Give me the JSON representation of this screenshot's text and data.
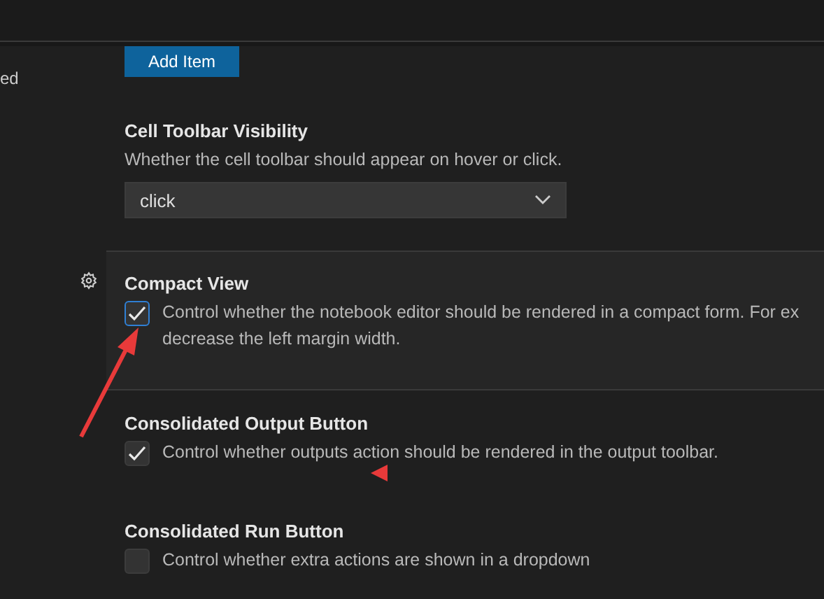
{
  "sidebar": {
    "items": [
      "ed"
    ]
  },
  "add_button": {
    "label": "Add Item"
  },
  "settings": [
    {
      "kind": "dropdown",
      "title": "Cell Toolbar Visibility",
      "description": "Whether the cell toolbar should appear on hover or click.",
      "value": "click",
      "focused": false
    },
    {
      "kind": "checkbox",
      "title": "Compact View",
      "description": "Control whether the notebook editor should be rendered in a compact form. For ex",
      "description_2": "decrease the left margin width.",
      "checked": true,
      "focused": true
    },
    {
      "kind": "checkbox",
      "title": "Consolidated Output Button",
      "description": "Control whether outputs action should be rendered in the output toolbar.",
      "checked": true,
      "focused": false
    },
    {
      "kind": "checkbox",
      "title": "Consolidated Run Button",
      "description": "Control whether extra actions are shown in a dropdown",
      "checked": false,
      "focused": false
    }
  ]
}
